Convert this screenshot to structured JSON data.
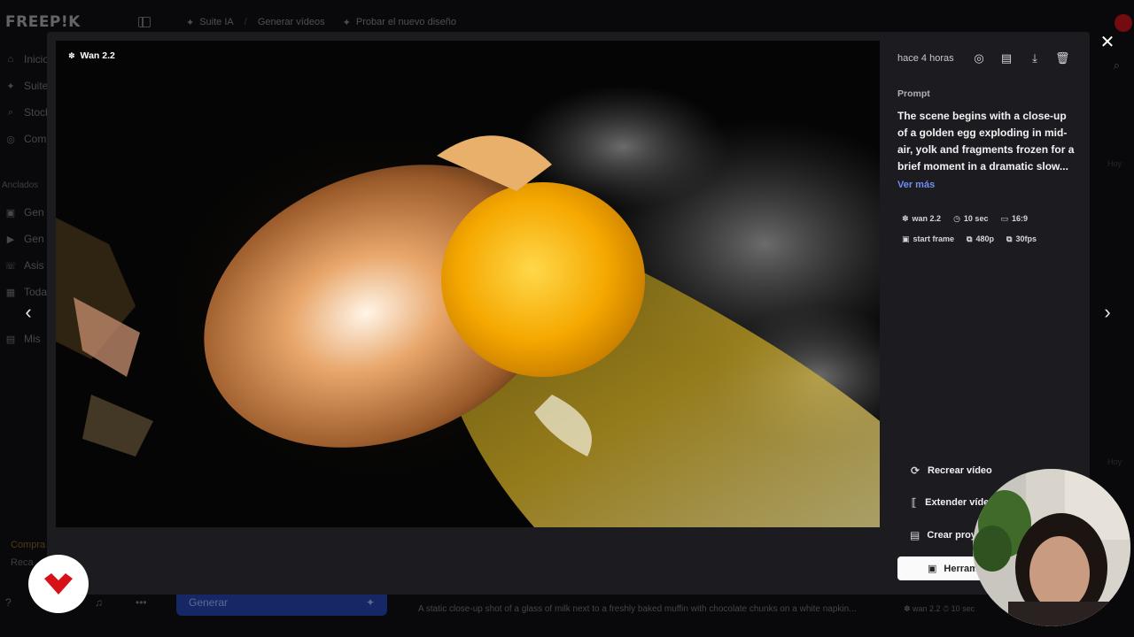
{
  "app": {
    "logo": "FREEP!K",
    "breadcrumbs": [
      {
        "label": "Suite IA",
        "icon": "sparkle-icon"
      },
      {
        "label": "Generar vídeos"
      },
      {
        "label": "Probar el nuevo diseño",
        "icon": "sparkle-icon"
      }
    ]
  },
  "sidebar": {
    "items": [
      {
        "label": "Inicio",
        "icon": "home-icon"
      },
      {
        "label": "Suite",
        "icon": "sparkle-icon"
      },
      {
        "label": "Stock",
        "icon": "search-icon"
      },
      {
        "label": "Com",
        "icon": "globe-icon"
      }
    ],
    "pinned_label": "Anclados",
    "pinned": [
      {
        "label": "Gen",
        "icon": "image-icon"
      },
      {
        "label": "Gen",
        "icon": "video-icon"
      },
      {
        "label": "Asis",
        "icon": "assistant-icon"
      },
      {
        "label": "Toda",
        "icon": "grid-icon"
      },
      {
        "label": "Mis",
        "icon": "folder-icon"
      }
    ],
    "promo_title": "Compra",
    "promo_sub": "Reca"
  },
  "background": {
    "generate_label": "Generar",
    "prompt_preview": "A static close-up shot of a glass of milk next to a freshly baked muffin with chocolate chunks on a white napkin...",
    "chips_preview": "✽ wan 2.2    ⏱ 10 sec",
    "ghost_label": "Hoy"
  },
  "viewer": {
    "model_tag": "Wan 2.2",
    "time_ago": "hace 4 horas",
    "prompt_label": "Prompt",
    "prompt_text": "The scene begins with a close-up of a golden egg exploding in mid-air, yolk and fragments frozen for a brief moment in a dramatic slow...",
    "see_more": "Ver más",
    "chips_row1": [
      {
        "icon": "model-icon",
        "glyph": "✽",
        "label": "wan 2.2"
      },
      {
        "icon": "clock-icon",
        "glyph": "◷",
        "label": "10 sec"
      },
      {
        "icon": "aspect-ratio-icon",
        "glyph": "▭",
        "label": "16:9"
      }
    ],
    "chips_row2": [
      {
        "icon": "image-icon",
        "glyph": "▣",
        "label": "start frame"
      },
      {
        "icon": "resolution-icon",
        "glyph": "⧉",
        "label": "480p"
      },
      {
        "icon": "fps-icon",
        "glyph": "⧉",
        "label": "30fps"
      }
    ],
    "actions": [
      {
        "label": "Recrear vídeo",
        "icon": "refresh-icon",
        "glyph": "⟳"
      },
      {
        "label": "Extender vídeo",
        "icon": "extend-icon",
        "glyph": "⟦"
      },
      {
        "label": "Crear proyecto",
        "icon": "project-icon",
        "glyph": "▤"
      }
    ],
    "tools_label": "Herramientas"
  }
}
